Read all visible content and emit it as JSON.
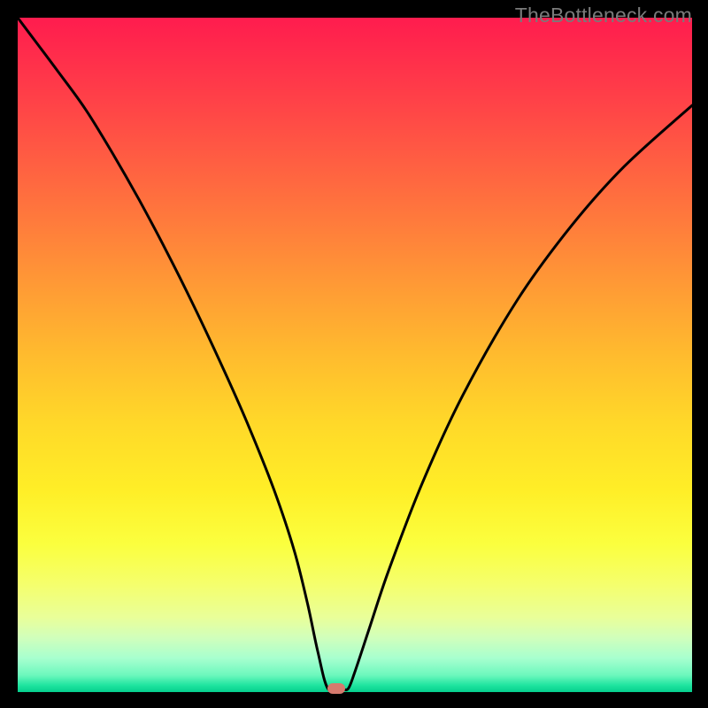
{
  "watermark": "TheBottleneck.com",
  "colors": {
    "frame_background": "#000000",
    "curve_stroke": "#000000",
    "marker_fill": "#d67a6e",
    "watermark_text": "#7a7a7a",
    "gradient_stops": [
      "#ff1c4e",
      "#ff3a49",
      "#ff5a43",
      "#ff7a3c",
      "#ff9b35",
      "#ffbb2e",
      "#ffd829",
      "#ffee27",
      "#fbff3e",
      "#f5ff6c",
      "#e9ff9a",
      "#d0ffbc",
      "#a7ffcf",
      "#6cf8bd",
      "#1fe49f",
      "#05cf8d"
    ]
  },
  "chart_data": {
    "type": "line",
    "title": "",
    "xlabel": "",
    "ylabel": "",
    "xlim": [
      0,
      100
    ],
    "ylim": [
      0,
      100
    ],
    "notes": "V-shaped bottleneck curve on a vertical red-to-green gradient. Y≈0 is green (balanced); Y≈100 is red (severe bottleneck). Minimum (optimal point) near x≈46, y≈0. Red pill marker sits at the minimum. No axis ticks or legend shown.",
    "series": [
      {
        "name": "bottleneck-curve",
        "x": [
          0,
          3,
          6,
          10,
          14,
          18,
          22,
          26,
          30,
          34,
          38,
          41,
          43,
          44.5,
          46,
          48,
          49,
          50,
          52,
          55,
          60,
          66,
          74,
          82,
          90,
          100
        ],
        "y": [
          100,
          96,
          92,
          86.5,
          80,
          73,
          65.5,
          57.5,
          49,
          40,
          30,
          21,
          13,
          6,
          0.5,
          0.5,
          0.5,
          3,
          9,
          18,
          31,
          44,
          58,
          69,
          78,
          87
        ]
      }
    ],
    "marker": {
      "x": 47.3,
      "y": 0.5
    }
  }
}
